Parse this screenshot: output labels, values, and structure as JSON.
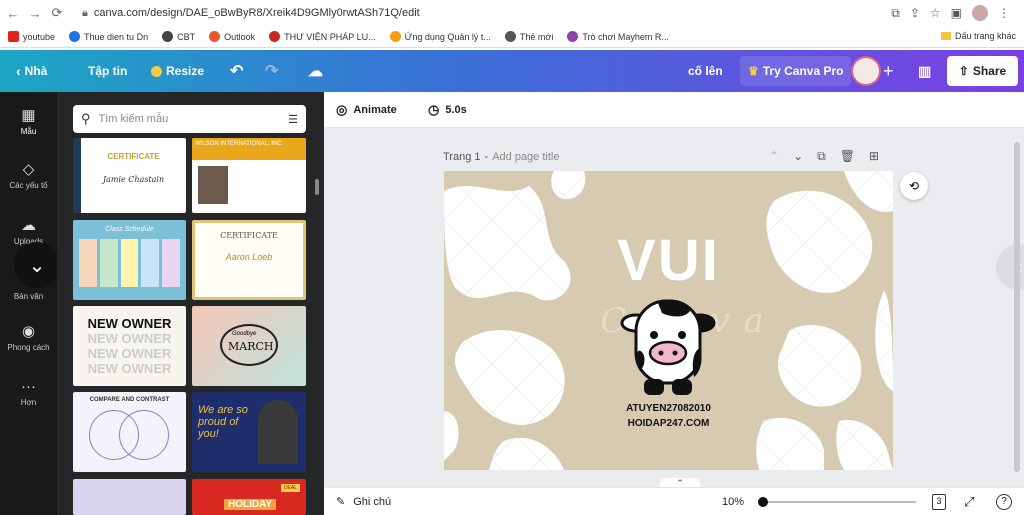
{
  "browser": {
    "url": "canva.com/design/DAE_oBwByR8/Xreik4D9GMly0rwtASh71Q/edit",
    "bookmarks": [
      {
        "label": "youtube",
        "color": "#e62117"
      },
      {
        "label": "Thue dien tu Dn",
        "color": "#1a73e8"
      },
      {
        "label": "CBT",
        "color": "#444444"
      },
      {
        "label": "Outlook",
        "color": "#e4572e"
      },
      {
        "label": "THƯ VIỆN PHÁP LU...",
        "color": "#c62828"
      },
      {
        "label": "Ứng dụng Quản lý t...",
        "color": "#f39c12"
      },
      {
        "label": "Thẻ mới",
        "color": "#555555"
      },
      {
        "label": "Trò chơi Mayhem R...",
        "color": "#8e44ad"
      }
    ],
    "other_bookmarks": "Dấu trang khác"
  },
  "topbar": {
    "home": "Nhà",
    "file": "Tập tin",
    "resize": "Resize",
    "save_status": "cố lên",
    "try_pro": "Try Canva Pro",
    "share": "Share"
  },
  "sidebar": {
    "items": [
      {
        "label": "Mẫu"
      },
      {
        "label": "Các yếu tố"
      },
      {
        "label": "Uploads"
      },
      {
        "label": "Bản văn"
      },
      {
        "label": "Phong cách"
      },
      {
        "label": "Hơn"
      }
    ]
  },
  "panel": {
    "search_placeholder": "Tìm kiếm mẫu",
    "templates": [
      {
        "title": "CERTIFICATE",
        "sub": "Jamie Chastain"
      },
      {
        "title": "WILSON INTERNATIONAL, INC."
      },
      {
        "title": "Class Schedule"
      },
      {
        "title": "CERTIFICATE",
        "sub": "Aaron Loeb"
      },
      {
        "title": "NEW OWNER"
      },
      {
        "title": "MARCH",
        "sub": "Goodbye"
      },
      {
        "title": "COMPARE AND CONTRAST"
      },
      {
        "title": "We are so proud of you!"
      },
      {
        "title": ""
      },
      {
        "title": "HOLIDAY",
        "sub": "DEAL"
      }
    ]
  },
  "editor": {
    "animate": "Animate",
    "duration": "5.0s",
    "page_label": "Trang 1",
    "page_title_placeholder": "Add page title",
    "design": {
      "headline": "VUI",
      "watermark": "Canva",
      "line1": "ATUYEN27082010",
      "line2": "HOIDAP247.COM"
    },
    "notes": "Ghi chú",
    "zoom": "10%",
    "page_count": "3"
  },
  "colors": {
    "canva_bg": "#d6cab0",
    "accent_gradient_start": "#1ca7c4",
    "accent_gradient_end": "#7b3fe4"
  }
}
